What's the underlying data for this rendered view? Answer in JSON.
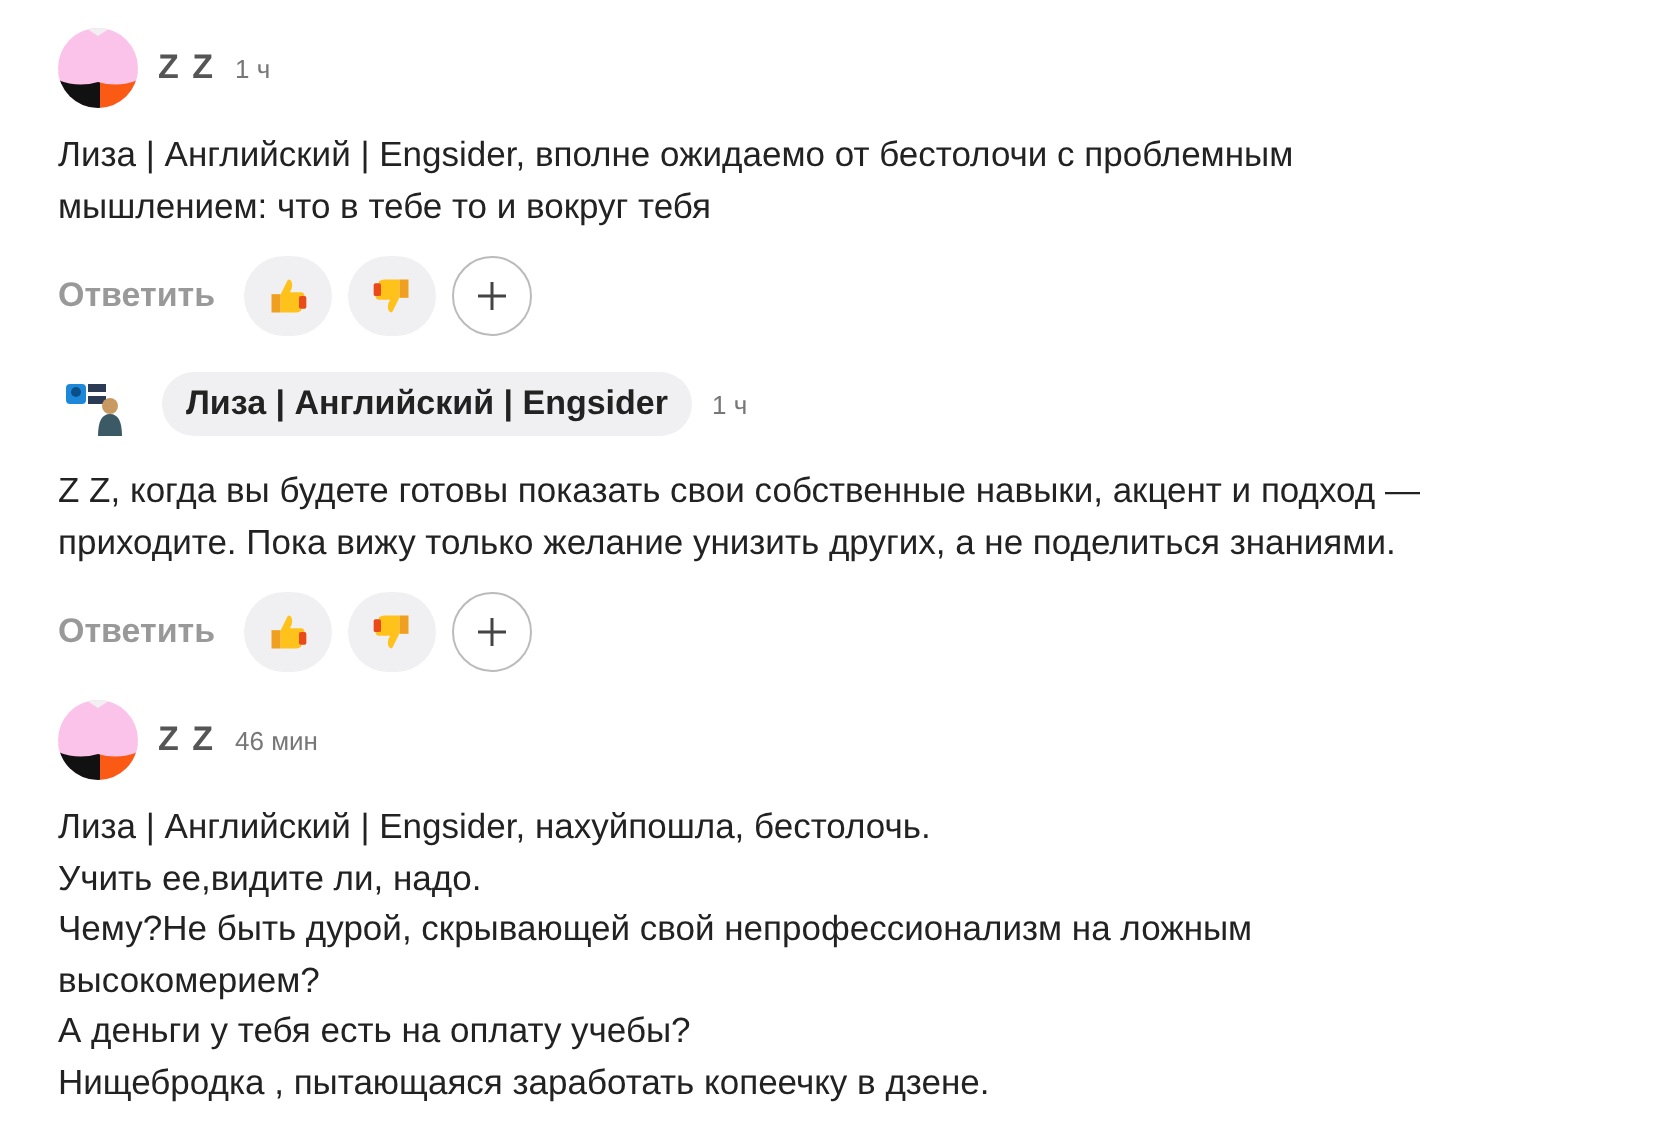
{
  "comments": [
    {
      "author": "Z Z",
      "highlighted": false,
      "time": "1 ч",
      "paragraphs": [
        "Лиза | Английский | Engsider, вполне ожидаемо от бестолочи с проблемным мышлением: что в тебе то и вокруг тебя"
      ],
      "actions": {
        "reply": "Ответить",
        "reactions": [
          {
            "kind": "like"
          },
          {
            "kind": "dislike"
          },
          {
            "kind": "add"
          }
        ]
      }
    },
    {
      "author": "Лиза | Английский | Engsider",
      "highlighted": true,
      "time": "1 ч",
      "paragraphs": [
        "Z Z, когда вы будете готовы показать свои собственные навыки, акцент и подход — приходите. Пока вижу только желание унизить других, а не поделиться знаниями."
      ],
      "actions": {
        "reply": "Ответить",
        "reactions": [
          {
            "kind": "like"
          },
          {
            "kind": "dislike"
          },
          {
            "kind": "add"
          }
        ]
      }
    },
    {
      "author": "Z Z",
      "highlighted": false,
      "time": "46 мин",
      "paragraphs": [
        "Лиза | Английский | Engsider, нахуйпошла, бестолочь.",
        "Учить ее,видите ли, надо.",
        "Чему?Не быть дурой, скрывающей свой непрофессионализм на ложным высокомерием?",
        "А деньги у тебя есть на оплату учебы?",
        "Нищебродка , пытающаяся заработать копеечку в дзене."
      ]
    }
  ]
}
